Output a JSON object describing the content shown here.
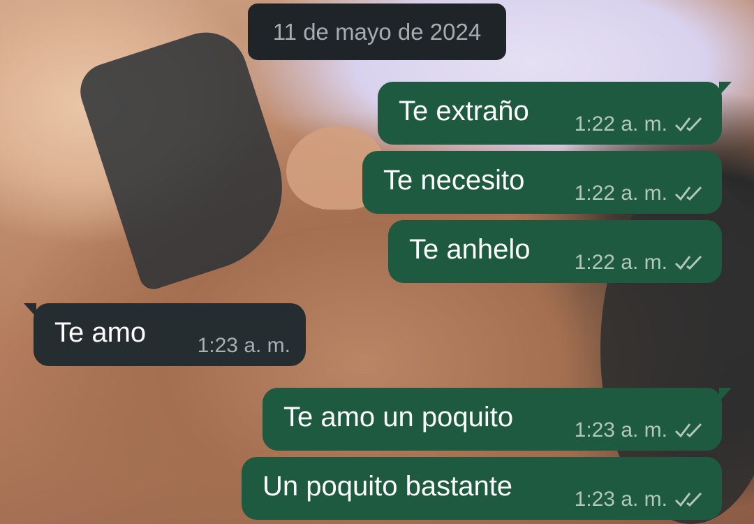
{
  "chat": {
    "date_separator": "11 de mayo de 2024",
    "messages": [
      {
        "direction": "out",
        "text": "Te extraño",
        "time": "1:22 a. m.",
        "status_icon": "double-check-icon"
      },
      {
        "direction": "out",
        "text": "Te necesito",
        "time": "1:22 a. m.",
        "status_icon": "double-check-icon"
      },
      {
        "direction": "out",
        "text": "Te anhelo",
        "time": "1:22 a. m.",
        "status_icon": "double-check-icon"
      },
      {
        "direction": "in",
        "text": "Te amo",
        "time": "1:23 a. m."
      },
      {
        "direction": "out",
        "text": "Te amo un poquito",
        "time": "1:23 a. m.",
        "status_icon": "double-check-icon"
      },
      {
        "direction": "out",
        "text": "Un poquito bastante",
        "time": "1:23 a. m.",
        "status_icon": "double-check-icon"
      }
    ]
  },
  "colors": {
    "outgoing_bubble": "#1e5a3f",
    "incoming_bubble": "#262d31",
    "date_chip": "#1f2428"
  }
}
